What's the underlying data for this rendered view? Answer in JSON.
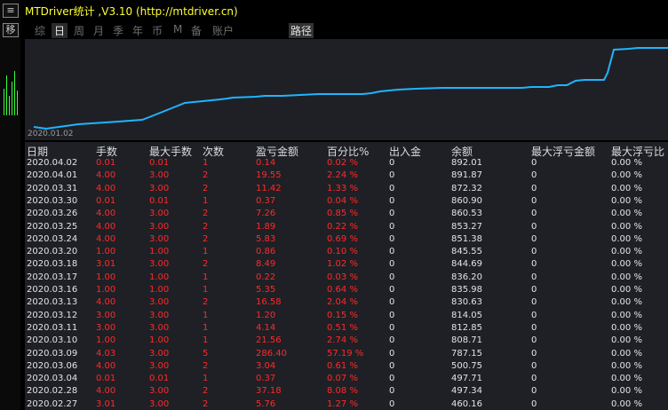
{
  "window": {
    "title": "MTDriver统计 ,V3.10 (http://mtdriver.cn)"
  },
  "left_strip": {
    "button_top": "≡",
    "button_mid": "移"
  },
  "tabs": [
    {
      "label": "综",
      "state": "normal"
    },
    {
      "label": "日",
      "state": "active"
    },
    {
      "label": "周",
      "state": "normal"
    },
    {
      "label": "月",
      "state": "normal"
    },
    {
      "label": "季",
      "state": "normal"
    },
    {
      "label": "年",
      "state": "normal"
    },
    {
      "label": "币",
      "state": "normal"
    },
    {
      "label": "M",
      "state": "normal"
    },
    {
      "label": "备",
      "state": "normal"
    },
    {
      "label": "账户",
      "state": "normal"
    },
    {
      "label": "路径",
      "state": "lead"
    }
  ],
  "equity_chart": {
    "type": "line",
    "start_date_label": "2020.01.02",
    "line_color": "#1fb5ff",
    "background": "#1e2025"
  },
  "table": {
    "columns": [
      "日期",
      "手数",
      "最大手数",
      "次数",
      "盈亏金额",
      "百分比%",
      "出入金",
      "余额",
      "最大浮亏金额",
      "最大浮亏比"
    ],
    "rows": [
      [
        "2020.04.02",
        "0.01",
        "0.01",
        "1",
        "0.14",
        "0.02 %",
        "0",
        "892.01",
        "0",
        "0.00 %"
      ],
      [
        "2020.04.01",
        "4.00",
        "3.00",
        "2",
        "19.55",
        "2.24 %",
        "0",
        "891.87",
        "0",
        "0.00 %"
      ],
      [
        "2020.03.31",
        "4.00",
        "3.00",
        "2",
        "11.42",
        "1.33 %",
        "0",
        "872.32",
        "0",
        "0.00 %"
      ],
      [
        "2020.03.30",
        "0.01",
        "0.01",
        "1",
        "0.37",
        "0.04 %",
        "0",
        "860.90",
        "0",
        "0.00 %"
      ],
      [
        "2020.03.26",
        "4.00",
        "3.00",
        "2",
        "7.26",
        "0.85 %",
        "0",
        "860.53",
        "0",
        "0.00 %"
      ],
      [
        "2020.03.25",
        "4.00",
        "3.00",
        "2",
        "1.89",
        "0.22 %",
        "0",
        "853.27",
        "0",
        "0.00 %"
      ],
      [
        "2020.03.24",
        "4.00",
        "3.00",
        "2",
        "5.83",
        "0.69 %",
        "0",
        "851.38",
        "0",
        "0.00 %"
      ],
      [
        "2020.03.20",
        "1.00",
        "1.00",
        "1",
        "0.86",
        "0.10 %",
        "0",
        "845.55",
        "0",
        "0.00 %"
      ],
      [
        "2020.03.18",
        "3.01",
        "3.00",
        "2",
        "8.49",
        "1.02 %",
        "0",
        "844.69",
        "0",
        "0.00 %"
      ],
      [
        "2020.03.17",
        "1.00",
        "1.00",
        "1",
        "0.22",
        "0.03 %",
        "0",
        "836.20",
        "0",
        "0.00 %"
      ],
      [
        "2020.03.16",
        "1.00",
        "1.00",
        "1",
        "5.35",
        "0.64 %",
        "0",
        "835.98",
        "0",
        "0.00 %"
      ],
      [
        "2020.03.13",
        "4.00",
        "3.00",
        "2",
        "16.58",
        "2.04 %",
        "0",
        "830.63",
        "0",
        "0.00 %"
      ],
      [
        "2020.03.12",
        "3.00",
        "3.00",
        "1",
        "1.20",
        "0.15 %",
        "0",
        "814.05",
        "0",
        "0.00 %"
      ],
      [
        "2020.03.11",
        "3.00",
        "3.00",
        "1",
        "4.14",
        "0.51 %",
        "0",
        "812.85",
        "0",
        "0.00 %"
      ],
      [
        "2020.03.10",
        "1.00",
        "1.00",
        "1",
        "21.56",
        "2.74 %",
        "0",
        "808.71",
        "0",
        "0.00 %"
      ],
      [
        "2020.03.09",
        "4.03",
        "3.00",
        "5",
        "286.40",
        "57.19 %",
        "0",
        "787.15",
        "0",
        "0.00 %"
      ],
      [
        "2020.03.06",
        "4.00",
        "3.00",
        "2",
        "3.04",
        "0.61 %",
        "0",
        "500.75",
        "0",
        "0.00 %"
      ],
      [
        "2020.03.04",
        "0.01",
        "0.01",
        "1",
        "0.37",
        "0.07 %",
        "0",
        "497.71",
        "0",
        "0.00 %"
      ],
      [
        "2020.02.28",
        "4.00",
        "3.00",
        "2",
        "37.18",
        "8.08 %",
        "0",
        "497.34",
        "0",
        "0.00 %"
      ],
      [
        "2020.02.27",
        "3.01",
        "3.00",
        "2",
        "5.76",
        "1.27 %",
        "0",
        "460.16",
        "0",
        "0.00 %"
      ]
    ]
  }
}
